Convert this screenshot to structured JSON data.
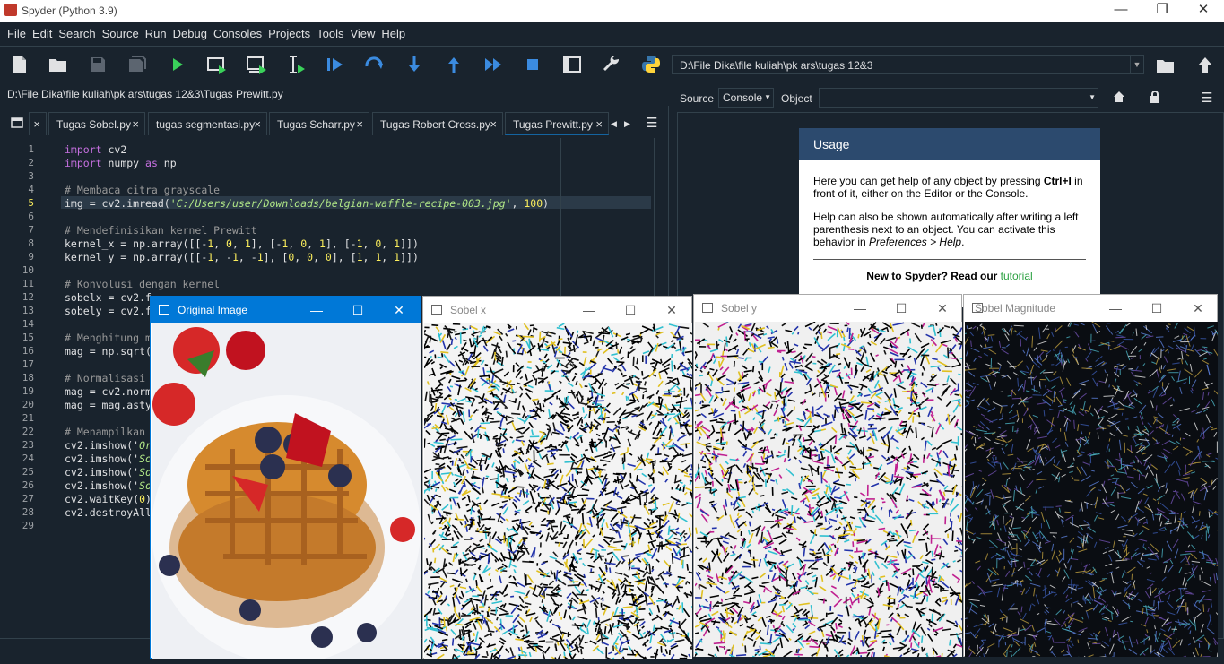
{
  "window": {
    "title": "Spyder (Python 3.9)"
  },
  "menu": [
    "File",
    "Edit",
    "Search",
    "Source",
    "Run",
    "Debug",
    "Consoles",
    "Projects",
    "Tools",
    "View",
    "Help"
  ],
  "toolbar": {
    "icons": [
      "new-file",
      "open-file",
      "save",
      "save-all",
      "run",
      "run-cell",
      "run-cell-advance",
      "run-selection",
      "debug",
      "step",
      "step-into",
      "step-return",
      "continue",
      "stop",
      "maximize-pane",
      "preferences",
      "python-path"
    ],
    "working_dir": "D:\\File Dika\\file kuliah\\pk ars\\tugas 12&3"
  },
  "editor": {
    "file_path": "D:\\File Dika\\file kuliah\\pk ars\\tugas 12&3\\Tugas Prewitt.py",
    "tabs": [
      {
        "label": "Tugas Sobel.py"
      },
      {
        "label": "tugas segmentasi.py"
      },
      {
        "label": "Tugas Scharr.py"
      },
      {
        "label": "Tugas Robert Cross.py"
      },
      {
        "label": "Tugas Prewitt.py"
      }
    ],
    "active_line": 5,
    "lines": [
      [
        {
          "t": "import",
          "c": "kw"
        },
        {
          "t": " cv2"
        }
      ],
      [
        {
          "t": "import",
          "c": "kw"
        },
        {
          "t": " numpy "
        },
        {
          "t": "as",
          "c": "kw"
        },
        {
          "t": " np"
        }
      ],
      [],
      [
        {
          "t": "# Membaca citra grayscale",
          "c": "cm"
        }
      ],
      [
        {
          "t": "img = cv2.imread("
        },
        {
          "t": "'C:/Users/user/Downloads/belgian-waffle-recipe-003.jpg'",
          "c": "st"
        },
        {
          "t": ", "
        },
        {
          "t": "100",
          "c": "nm"
        },
        {
          "t": ")"
        }
      ],
      [],
      [
        {
          "t": "# Mendefinisikan kernel Prewitt",
          "c": "cm"
        }
      ],
      [
        {
          "t": "kernel_x = np.array([[-"
        },
        {
          "t": "1",
          "c": "nm"
        },
        {
          "t": ", "
        },
        {
          "t": "0",
          "c": "nm"
        },
        {
          "t": ", "
        },
        {
          "t": "1",
          "c": "nm"
        },
        {
          "t": "], [-"
        },
        {
          "t": "1",
          "c": "nm"
        },
        {
          "t": ", "
        },
        {
          "t": "0",
          "c": "nm"
        },
        {
          "t": ", "
        },
        {
          "t": "1",
          "c": "nm"
        },
        {
          "t": "], [-"
        },
        {
          "t": "1",
          "c": "nm"
        },
        {
          "t": ", "
        },
        {
          "t": "0",
          "c": "nm"
        },
        {
          "t": ", "
        },
        {
          "t": "1",
          "c": "nm"
        },
        {
          "t": "]])"
        }
      ],
      [
        {
          "t": "kernel_y = np.array([[-"
        },
        {
          "t": "1",
          "c": "nm"
        },
        {
          "t": ", -"
        },
        {
          "t": "1",
          "c": "nm"
        },
        {
          "t": ", -"
        },
        {
          "t": "1",
          "c": "nm"
        },
        {
          "t": "], ["
        },
        {
          "t": "0",
          "c": "nm"
        },
        {
          "t": ", "
        },
        {
          "t": "0",
          "c": "nm"
        },
        {
          "t": ", "
        },
        {
          "t": "0",
          "c": "nm"
        },
        {
          "t": "], ["
        },
        {
          "t": "1",
          "c": "nm"
        },
        {
          "t": ", "
        },
        {
          "t": "1",
          "c": "nm"
        },
        {
          "t": ", "
        },
        {
          "t": "1",
          "c": "nm"
        },
        {
          "t": "]])"
        }
      ],
      [],
      [
        {
          "t": "# Konvolusi dengan kernel",
          "c": "cm"
        }
      ],
      [
        {
          "t": "sobelx = cv2.f"
        }
      ],
      [
        {
          "t": "sobely = cv2.f"
        }
      ],
      [],
      [
        {
          "t": "# Menghitung m",
          "c": "cm"
        }
      ],
      [
        {
          "t": "mag = np.sqrt("
        }
      ],
      [],
      [
        {
          "t": "# Normalisasi",
          "c": "cm"
        }
      ],
      [
        {
          "t": "mag = cv2.norm"
        }
      ],
      [
        {
          "t": "mag = mag.asty"
        }
      ],
      [],
      [
        {
          "t": "# Menampilkan",
          "c": "cm"
        }
      ],
      [
        {
          "t": "cv2.imshow('"
        },
        {
          "t": "Or",
          "c": "st"
        }
      ],
      [
        {
          "t": "cv2.imshow('"
        },
        {
          "t": "So",
          "c": "st"
        }
      ],
      [
        {
          "t": "cv2.imshow('"
        },
        {
          "t": "So",
          "c": "st"
        }
      ],
      [
        {
          "t": "cv2.imshow('"
        },
        {
          "t": "So",
          "c": "st"
        }
      ],
      [
        {
          "t": "cv2.waitKey("
        },
        {
          "t": "0",
          "c": "nm"
        },
        {
          "t": ")"
        }
      ],
      [
        {
          "t": "cv2.destroyAll"
        }
      ],
      []
    ]
  },
  "help": {
    "source_label": "Source",
    "source_value": "Console",
    "object_label": "Object",
    "usage_title": "Usage",
    "p1_a": "Here you can get help of any object by pressing ",
    "p1_b": "Ctrl+I",
    "p1_c": " in front of it, either on the Editor or the Console.",
    "p2_a": "Help can also be shown automatically after writing a left parenthesis next to an object. You can activate this behavior in ",
    "p2_b": "Preferences > Help",
    "p2_c": ".",
    "new_a": "New to Spyder? Read our ",
    "new_b": "tutorial"
  },
  "windows": [
    {
      "title": "Original Image",
      "active": true
    },
    {
      "title": "Sobel x",
      "active": false
    },
    {
      "title": "Sobel y",
      "active": false
    },
    {
      "title": "Sobel Magnitude",
      "active": false
    }
  ],
  "colors": {
    "bg": "#19232d",
    "border": "#32414b",
    "accent": "#1464a0",
    "active_title": "#0078d7"
  }
}
